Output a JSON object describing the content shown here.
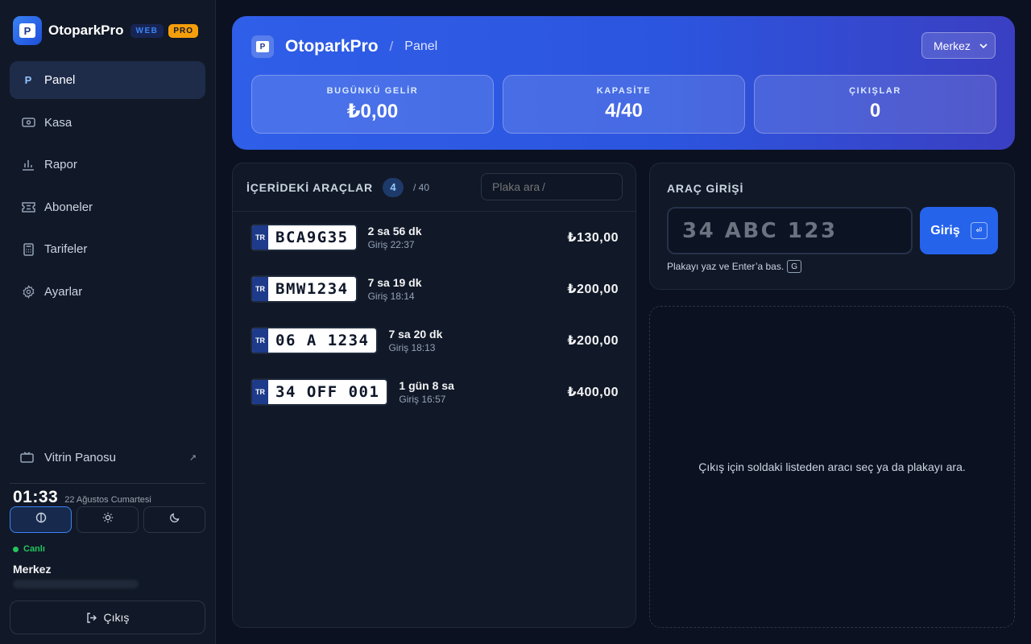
{
  "sidebar": {
    "brand": "OtoparkPro",
    "logo_letter": "P",
    "tag_web": "WEB",
    "tag_pro": "PRO",
    "nav": [
      {
        "label": "Panel",
        "icon": "p-letter-icon",
        "glyph": "P",
        "active": true
      },
      {
        "label": "Kasa",
        "icon": "cash-icon",
        "active": false
      },
      {
        "label": "Rapor",
        "icon": "bar-chart-icon",
        "active": false
      },
      {
        "label": "Aboneler",
        "icon": "ticket-icon",
        "active": false
      },
      {
        "label": "Tarifeler",
        "icon": "calculator-icon",
        "active": false
      },
      {
        "label": "Ayarlar",
        "icon": "gear-icon",
        "active": false
      }
    ],
    "showcase": {
      "label": "Vitrin Panosu",
      "icon": "tv-icon",
      "arrow": "↗"
    },
    "clock": "01:33",
    "date": "22 Ağustos Cumartesi",
    "theme": {
      "selected": "auto"
    },
    "status": "Canlı",
    "status_color": "#22c55e",
    "branch": "Merkez",
    "logout": "Çıkış"
  },
  "header": {
    "brand": "OtoparkPro",
    "separator": "/",
    "page": "Panel",
    "branch_select": "Merkez",
    "stats": [
      {
        "label": "BUGÜNKÜ GELİR",
        "value": "₺0,00"
      },
      {
        "label": "KAPASİTE",
        "value": "4/40"
      },
      {
        "label": "ÇIKIŞLAR",
        "value": "0"
      }
    ]
  },
  "vehicles": {
    "title": "İÇERİDEKİ ARAÇLAR",
    "count": "4",
    "capacity": "/ 40",
    "search_placeholder": "Plaka ara",
    "search_key": "/",
    "plate_country": "TR",
    "items": [
      {
        "plate": "BCA9G35",
        "duration": "2 sa 56 dk",
        "entry": "Giriş 22:37",
        "price": "₺130,00"
      },
      {
        "plate": "BMW1234",
        "duration": "7 sa 19 dk",
        "entry": "Giriş 18:14",
        "price": "₺200,00"
      },
      {
        "plate": "06 A 1234",
        "duration": "7 sa 20 dk",
        "entry": "Giriş 18:13",
        "price": "₺200,00"
      },
      {
        "plate": "34 OFF 001",
        "duration": "1 gün 8 sa",
        "entry": "Giriş 16:57",
        "price": "₺400,00"
      }
    ]
  },
  "entry": {
    "title": "ARAÇ GİRİŞİ",
    "placeholder": "34 ABC 123",
    "button": "Giriş",
    "button_key": "⏎",
    "hint": "Plakayı yaz ve Enter’a bas.",
    "hint_key": "G"
  },
  "exit": {
    "message": "Çıkış için soldaki listeden aracı seç ya da plakayı ara."
  },
  "colors": {
    "accent": "#2563eb",
    "background": "#0b1120",
    "panel": "#111827"
  }
}
